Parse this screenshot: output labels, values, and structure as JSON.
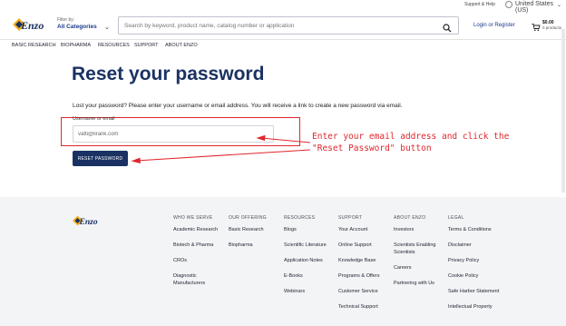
{
  "topbar": {
    "support_help": "Support & Help",
    "region": "United States (US)"
  },
  "header": {
    "filter_label": "Filter by:",
    "filter_value": "All Categories",
    "search_placeholder": "Search by keyword, product name, catalog number or application",
    "login": "Login or Register",
    "cart_amount": "$0.00",
    "cart_products": "0 products"
  },
  "nav": [
    "BASIC RESEARCH",
    "BIOPHARMA",
    "RESOURCES",
    "SUPPORT",
    "ABOUT ENZO"
  ],
  "main": {
    "title": "Reset your password",
    "description": "Lost your password? Please enter your username or email address. You will receive a link to create a new password via email.",
    "field_label": "Username or email",
    "field_value": "vatti@lirank.com",
    "button": "RESET PASSWORD"
  },
  "annotation": {
    "text": "Enter your email address and click the\n\"Reset Password\" button",
    "color": "#e0262d"
  },
  "footer": {
    "columns": [
      {
        "heading": "WHO WE SERVE",
        "links": [
          "Academic Research",
          "Biotech & Pharma",
          "CROs",
          "Diagnostic Manufacturers"
        ]
      },
      {
        "heading": "OUR OFFERING",
        "links": [
          "Basic Research",
          "Biopharma"
        ]
      },
      {
        "heading": "RESOURCES",
        "links": [
          "Blogs",
          "Scientific Literature",
          "Application Notes",
          "E-Books",
          "Webinars"
        ]
      },
      {
        "heading": "SUPPORT",
        "links": [
          "Your Account",
          "Online Support",
          "Knowledge Base",
          "Programs & Offers",
          "Customer Service",
          "Technical Support"
        ]
      },
      {
        "heading": "ABOUT ENZO",
        "links": [
          "Investors",
          "Scientists Enabling Scientists",
          "Careers",
          "Partnering with Us"
        ]
      },
      {
        "heading": "LEGAL",
        "links": [
          "Terms & Conditions",
          "Disclaimer",
          "Privacy Policy",
          "Cookie Policy",
          "Safe Harbor Statement",
          "Intellectual Property"
        ]
      }
    ]
  },
  "colors": {
    "brand_navy": "#1a3263",
    "link_blue": "#1b3a8a",
    "footer_bg": "#f3f4f6"
  }
}
